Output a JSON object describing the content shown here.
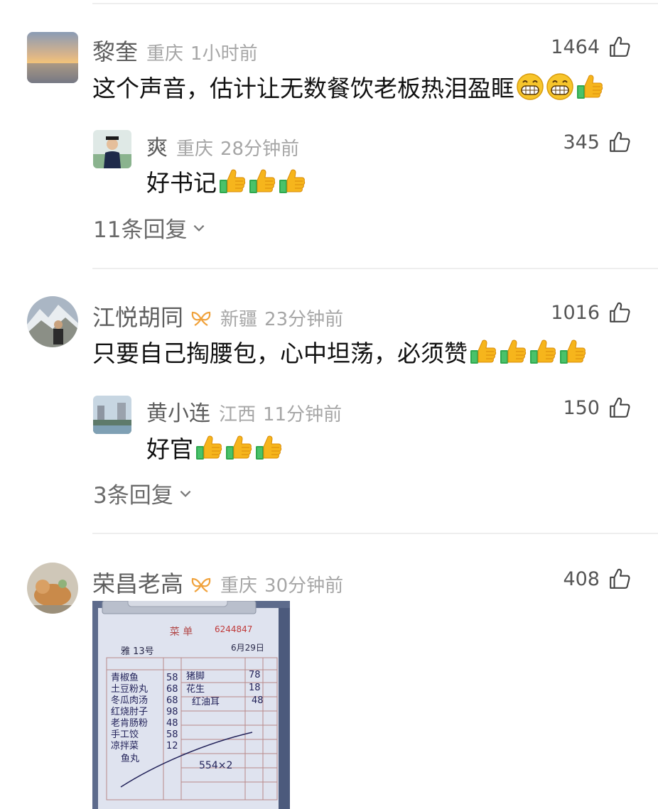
{
  "comments": [
    {
      "name": "黎奎",
      "location": "重庆",
      "time": "1小时前",
      "likes": "1464",
      "text": "这个声音，估计让无数餐饮老板热泪盈眶",
      "reply": {
        "name": "爽",
        "location": "重庆",
        "time": "28分钟前",
        "likes": "345",
        "text": "好书记"
      },
      "more_replies": "11条回复"
    },
    {
      "name": "江悦胡同",
      "location": "新疆",
      "time": "23分钟前",
      "likes": "1016",
      "text": "只要自己掏腰包，心中坦荡，必须赞",
      "reply": {
        "name": "黄小连",
        "location": "江西",
        "time": "11分钟前",
        "likes": "150",
        "text": "好官"
      },
      "more_replies": "3条回复"
    },
    {
      "name": "荣昌老高",
      "location": "重庆",
      "time": "30分钟前",
      "likes": "408"
    }
  ],
  "receipt": {
    "title": "菜 单",
    "number": "6244847",
    "table_no": "雅 13号",
    "date": "6月29日",
    "items_left": [
      "青椒鱼",
      "土豆粉丸",
      "冬瓜肉汤",
      "红烧肘子",
      "老肯肠粉",
      "手工饺",
      "凉拌菜",
      "鱼丸"
    ],
    "prices_left": [
      "58",
      "68",
      "68",
      "98",
      "48",
      "58",
      "12"
    ],
    "items_right": [
      "猪脚",
      "花生",
      "红油耳"
    ],
    "prices_right": [
      "78",
      "18",
      "48"
    ],
    "total": "554×2"
  },
  "icons": {
    "like": "thumbs-up-outline-icon",
    "vip": "gold-ribbon-badge-icon",
    "expand": "chevron-down-icon",
    "grin": "grinning-emoji-icon",
    "thumb": "thumbs-up-emoji-icon"
  },
  "colors": {
    "name": "#5e5e5e",
    "meta": "#a6a6a6",
    "vip": "#f0a23c",
    "text": "#111111"
  }
}
